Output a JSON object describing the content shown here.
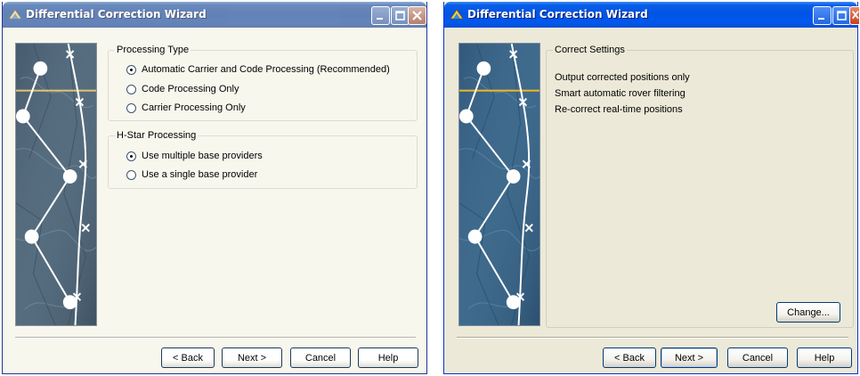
{
  "left": {
    "title": "Differential Correction Wizard",
    "groups": [
      {
        "legend": "Processing Type",
        "options": [
          {
            "label": "Automatic Carrier and Code Processing (Recommended)",
            "selected": true
          },
          {
            "label": "Code Processing Only",
            "selected": false
          },
          {
            "label": "Carrier Processing Only",
            "selected": false
          }
        ]
      },
      {
        "legend": "H-Star Processing",
        "options": [
          {
            "label": "Use multiple base providers",
            "selected": true
          },
          {
            "label": "Use a single base provider",
            "selected": false
          }
        ]
      }
    ],
    "buttons": {
      "back": "< Back",
      "next": "Next >",
      "cancel": "Cancel",
      "help": "Help"
    }
  },
  "right": {
    "title": "Differential Correction Wizard",
    "group_legend": "Correct Settings",
    "settings": [
      "Output corrected positions only",
      "Smart automatic rover filtering",
      "Re-correct real-time positions"
    ],
    "change_label": "Change...",
    "buttons": {
      "back": "< Back",
      "next": "Next >",
      "cancel": "Cancel",
      "help": "Help"
    }
  },
  "colors": {
    "titlebar": "#0054e3",
    "dialog": "#ece9d8",
    "art_blue": "#2e5a7e",
    "art_accent": "#f2b822"
  }
}
